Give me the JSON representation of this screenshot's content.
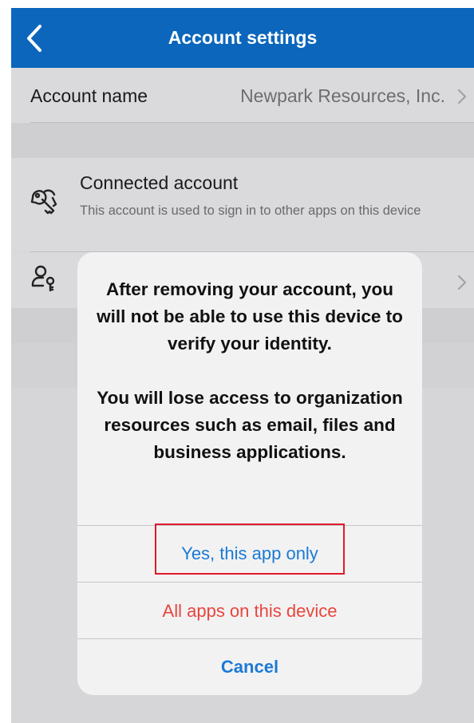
{
  "navbar": {
    "title": "Account settings",
    "back_icon": "chevron-left-icon"
  },
  "account_row": {
    "label": "Account name",
    "value": "Newpark Resources, Inc.",
    "chevron_icon": "chevron-right-icon"
  },
  "connected_row": {
    "icon": "keys-icon",
    "title": "Connected account",
    "description": "This account is used to sign in to other apps on this device"
  },
  "second_row": {
    "icon": "user-key-icon",
    "chevron_icon": "chevron-right-icon"
  },
  "dialog": {
    "message_1": "After removing your account, you will not be able to use this device to verify your identity.",
    "message_2": "You will lose access to organization resources such as email, files and business applications.",
    "buttons": {
      "yes_label": "Yes, this app only",
      "all_label": "All apps on this device",
      "cancel_label": "Cancel"
    }
  },
  "colors": {
    "navbar": "#0b66bc",
    "action_blue": "#1b7ad4",
    "destructive_red": "#e8453c",
    "highlight_red": "#e0192a"
  }
}
